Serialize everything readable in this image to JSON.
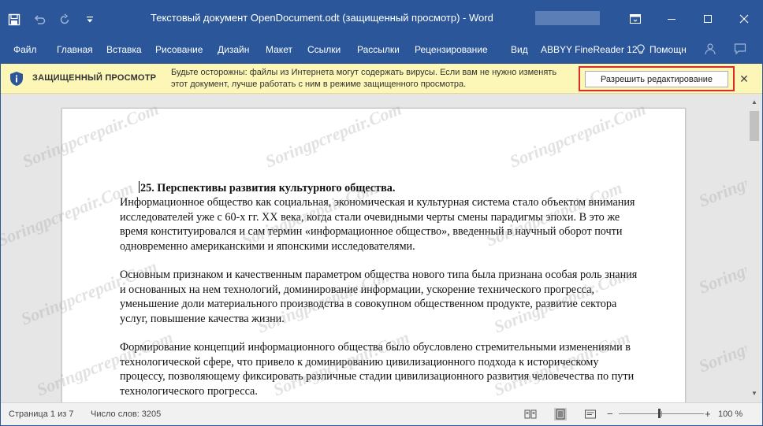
{
  "window": {
    "title": "Текстовый документ OpenDocument.odt (защищенный просмотр)  -  Word",
    "accent": "#2b579a"
  },
  "quick_access": {
    "icons": [
      "save-icon",
      "undo-icon",
      "redo-icon",
      "customize-icon"
    ]
  },
  "window_controls": {
    "icons": [
      "ribbon-display-icon",
      "minimize-icon",
      "maximize-icon",
      "close-icon"
    ]
  },
  "ribbon_tabs": [
    "Файл",
    "Главная",
    "Вставка",
    "Рисование",
    "Дизайн",
    "Макет",
    "Ссылки",
    "Рассылки",
    "Рецензирование",
    "Вид",
    "ABBYY FineReader 12"
  ],
  "help_label": "Помощн",
  "protected_view": {
    "title": "ЗАЩИЩЕННЫЙ ПРОСМОТР",
    "message": "Будьте осторожны: файлы из Интернета могут содержать вирусы. Если вам не нужно изменять этот документ, лучше работать с ним в режиме защищенного просмотра.",
    "enable_button": "Разрешить редактирование",
    "bar_color": "#fcf7b6",
    "highlight_color": "#e02b2b"
  },
  "document": {
    "heading": "25. Перспективы развития культурного общества.",
    "paragraph1": "Информационное общество как социальная, экономическая и культурная система стало объектом внимания исследователей уже с 60-х гг. XX века, когда стали очевидными черты смены парадигмы эпохи. В это же время конституировался и сам термин «информационное общество», введенный в научный оборот почти одновременно американскими и японскими исследователями.",
    "paragraph2": "Основным признаком и качественным параметром общества нового типа была признана особая роль знания и основанных на нем технологий, доминирование информации, ускорение технического прогресса, уменьшение доли материального производства в совокупном общественном продукте, развитие сектора услуг, повышение качества жизни.",
    "paragraph3": "Формирование концепций информационного общества было обусловлено стремительными изменениями в технологической сфере, что привело к доминированию цивилизационного подхода к историческому процессу, позволяющему фиксировать различные стадии цивилизационного развития человечества по пути технологического прогресса.",
    "watermark": "Soringpcrepair.Com"
  },
  "status": {
    "page": "Страница 1 из 7",
    "words": "Число слов: 3205",
    "zoom": "100 %",
    "zoom_level_percent": 100
  }
}
